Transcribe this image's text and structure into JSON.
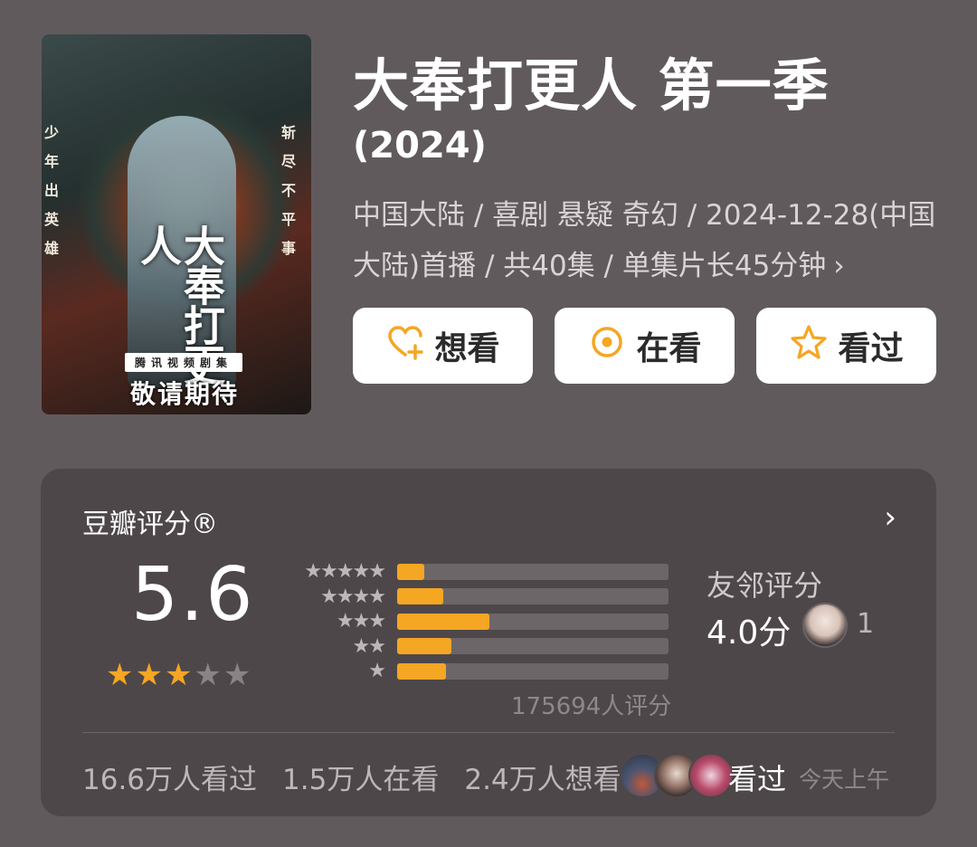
{
  "header": {
    "title": "大奉打更人 第一季",
    "year": "(2024)",
    "meta": "中国大陆 / 喜剧 悬疑 奇幻 / 2024-12-28(中国大陆)首播 / 共40集 / 单集片长45分钟",
    "meta_chevron": "›"
  },
  "poster": {
    "side_left": "少年出英雄",
    "side_right": "斩尽不平事",
    "title_art": "大奉打更人",
    "subtitle": "腾讯视频剧集",
    "cta": "敬请期待"
  },
  "actions": [
    {
      "label": "想看",
      "icon": "heart-plus-icon"
    },
    {
      "label": "在看",
      "icon": "target-icon"
    },
    {
      "label": "看过",
      "icon": "star-outline-icon"
    }
  ],
  "rating": {
    "label": "豆瓣评分®",
    "chevron": "›",
    "score": "5.6",
    "stars_filled": 3,
    "stars_total": 5,
    "distribution": [
      {
        "stars": "★★★★★",
        "fraction": 0.1
      },
      {
        "stars": "★★★★",
        "fraction": 0.17
      },
      {
        "stars": "★★★",
        "fraction": 0.34
      },
      {
        "stars": "★★",
        "fraction": 0.2
      },
      {
        "stars": "★",
        "fraction": 0.18
      }
    ],
    "rater_count": "175694人评分",
    "friend_label": "友邻评分",
    "friend_score": "4.0分",
    "friend_count": "1"
  },
  "stats": {
    "watched": "16.6万人看过",
    "watching": "1.5万人在看",
    "want": "2.4万人想看",
    "watched_label": "看过",
    "watched_time": "今天上午"
  },
  "colors": {
    "accent": "#f5a623",
    "background": "#615a5c",
    "card": "#4e4749"
  }
}
